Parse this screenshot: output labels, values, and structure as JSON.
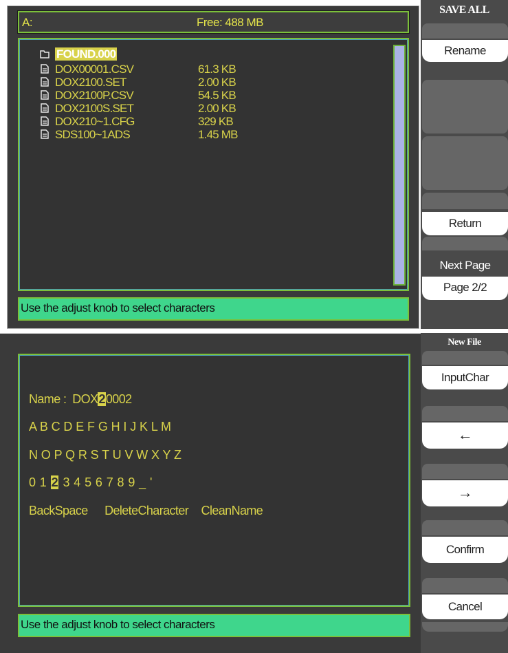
{
  "top": {
    "drive": "A:",
    "free": "Free: 488 MB",
    "files": [
      {
        "icon": "folder-icon",
        "name": "FOUND.000",
        "size": "",
        "selected": true
      },
      {
        "icon": "file-icon",
        "name": "DOX00001.CSV",
        "size": "61.3 KB"
      },
      {
        "icon": "file-icon",
        "name": "DOX2100.SET",
        "size": "2.00 KB"
      },
      {
        "icon": "file-icon",
        "name": "DOX2100P.CSV",
        "size": "54.5 KB"
      },
      {
        "icon": "file-icon",
        "name": "DOX2100S.SET",
        "size": "2.00 KB"
      },
      {
        "icon": "file-icon",
        "name": "DOX210~1.CFG",
        "size": "329 KB"
      },
      {
        "icon": "file-icon",
        "name": "SDS100~1ADS",
        "size": "1.45 MB"
      }
    ],
    "status": "Use the adjust knob to select characters",
    "menu": {
      "header": "SAVE ALL",
      "rename": "Rename",
      "return": "Return",
      "next_page": "Next Page",
      "page": "Page 2/2"
    }
  },
  "bottom": {
    "name_label": "Name :",
    "name_prefix": "DOX",
    "name_cursor": "2",
    "name_suffix": "0002",
    "row1": "A B C D E F G H I J K L M",
    "row2": "N O P Q R S T U V W X Y Z",
    "row3_pre": "0 1",
    "row3_sel": "2",
    "row3_post": "3 4 5 6 7 8 9 _ '",
    "actions": {
      "backspace": "BackSpace",
      "delete": "DeleteCharacter",
      "clean": "CleanName"
    },
    "status": "Use the adjust knob to select characters",
    "menu": {
      "header": "New File",
      "input_char": "InputChar",
      "left": "←",
      "right": "→",
      "confirm": "Confirm",
      "cancel": "Cancel"
    }
  },
  "colors": {
    "text_yellow": "#d8d24a",
    "frame_green": "#7cc13a",
    "status_green": "#3fd68c",
    "panel": "#3a3a3a"
  }
}
